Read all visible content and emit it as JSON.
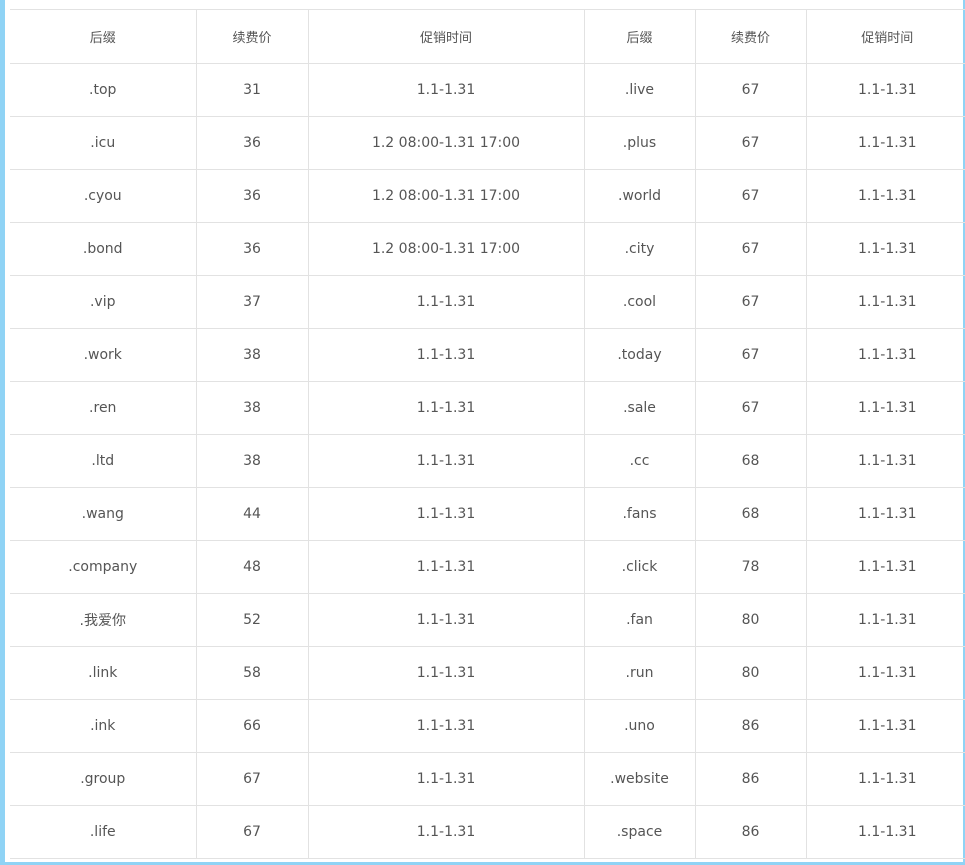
{
  "headers": [
    "后缀",
    "续费价",
    "促销时间",
    "后缀",
    "续费价",
    "促销时间"
  ],
  "rows": [
    [
      ".top",
      "31",
      "1.1-1.31",
      ".live",
      "67",
      "1.1-1.31"
    ],
    [
      ".icu",
      "36",
      "1.2 08:00-1.31 17:00",
      ".plus",
      "67",
      "1.1-1.31"
    ],
    [
      ".cyou",
      "36",
      "1.2 08:00-1.31 17:00",
      ".world",
      "67",
      "1.1-1.31"
    ],
    [
      ".bond",
      "36",
      "1.2 08:00-1.31 17:00",
      ".city",
      "67",
      "1.1-1.31"
    ],
    [
      ".vip",
      "37",
      "1.1-1.31",
      ".cool",
      "67",
      "1.1-1.31"
    ],
    [
      ".work",
      "38",
      "1.1-1.31",
      ".today",
      "67",
      "1.1-1.31"
    ],
    [
      ".ren",
      "38",
      "1.1-1.31",
      ".sale",
      "67",
      "1.1-1.31"
    ],
    [
      ".ltd",
      "38",
      "1.1-1.31",
      ".cc",
      "68",
      "1.1-1.31"
    ],
    [
      ".wang",
      "44",
      "1.1-1.31",
      ".fans",
      "68",
      "1.1-1.31"
    ],
    [
      ".company",
      "48",
      "1.1-1.31",
      ".click",
      "78",
      "1.1-1.31"
    ],
    [
      ".我爱你",
      "52",
      "1.1-1.31",
      ".fan",
      "80",
      "1.1-1.31"
    ],
    [
      ".link",
      "58",
      "1.1-1.31",
      ".run",
      "80",
      "1.1-1.31"
    ],
    [
      ".ink",
      "66",
      "1.1-1.31",
      ".uno",
      "86",
      "1.1-1.31"
    ],
    [
      ".group",
      "67",
      "1.1-1.31",
      ".website",
      "86",
      "1.1-1.31"
    ],
    [
      ".life",
      "67",
      "1.1-1.31",
      ".space",
      "86",
      "1.1-1.31"
    ]
  ],
  "colors": {
    "frame_accent": "#8fd3f5",
    "grid_line": "#e2e2e2",
    "text": "#555555"
  }
}
